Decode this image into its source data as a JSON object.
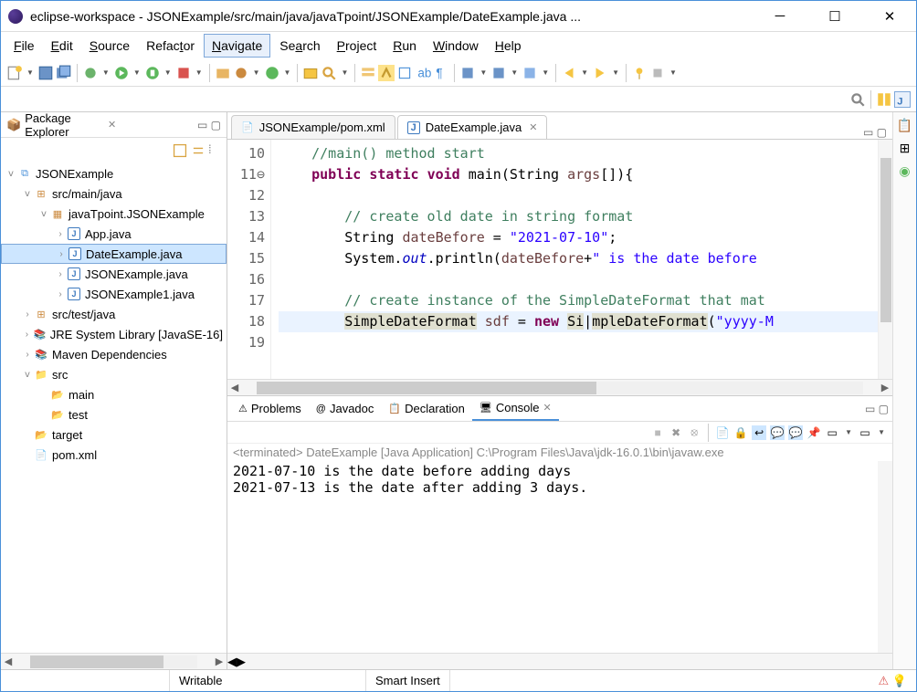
{
  "window": {
    "title": "eclipse-workspace - JSONExample/src/main/java/javaTpoint/JSONExample/DateExample.java ..."
  },
  "menu": {
    "file": "File",
    "edit": "Edit",
    "source": "Source",
    "refactor": "Refactor",
    "navigate": "Navigate",
    "search": "Search",
    "project": "Project",
    "run": "Run",
    "window": "Window",
    "help": "Help"
  },
  "package_explorer": {
    "title": "Package Explorer",
    "items": [
      {
        "label": "JSONExample",
        "depth": 0,
        "icon": "proj",
        "expand": "open"
      },
      {
        "label": "src/main/java",
        "depth": 1,
        "icon": "srcfolder",
        "expand": "open"
      },
      {
        "label": "javaTpoint.JSONExample",
        "depth": 2,
        "icon": "pkg",
        "expand": "open"
      },
      {
        "label": "App.java",
        "depth": 3,
        "icon": "java",
        "expand": "leaf"
      },
      {
        "label": "DateExample.java",
        "depth": 3,
        "icon": "java",
        "expand": "leaf",
        "selected": true
      },
      {
        "label": "JSONExample.java",
        "depth": 3,
        "icon": "java",
        "expand": "leaf"
      },
      {
        "label": "JSONExample1.java",
        "depth": 3,
        "icon": "java",
        "expand": "leaf"
      },
      {
        "label": "src/test/java",
        "depth": 1,
        "icon": "srcfolder",
        "expand": "closed"
      },
      {
        "label": "JRE System Library [JavaSE-16]",
        "depth": 1,
        "icon": "lib",
        "expand": "closed"
      },
      {
        "label": "Maven Dependencies",
        "depth": 1,
        "icon": "lib",
        "expand": "closed"
      },
      {
        "label": "src",
        "depth": 1,
        "icon": "folder",
        "expand": "open"
      },
      {
        "label": "main",
        "depth": 2,
        "icon": "folder-open",
        "expand": "none"
      },
      {
        "label": "test",
        "depth": 2,
        "icon": "folder-open",
        "expand": "none"
      },
      {
        "label": "target",
        "depth": 1,
        "icon": "folder-open",
        "expand": "none"
      },
      {
        "label": "pom.xml",
        "depth": 1,
        "icon": "xml",
        "expand": "none"
      }
    ]
  },
  "editor": {
    "tabs": [
      {
        "label": "JSONExample/pom.xml",
        "icon": "xml"
      },
      {
        "label": "DateExample.java",
        "icon": "java",
        "active": true
      }
    ],
    "lines": [
      {
        "num": "10",
        "html": "    <span class='c-cm'>//main() method start</span>"
      },
      {
        "num": "11",
        "html": "    <span class='c-kw'>public</span> <span class='c-kw'>static</span> <span class='c-kw'>void</span> main(String <span class='c-var'>args</span>[]){",
        "marker": "⊖"
      },
      {
        "num": "12",
        "html": ""
      },
      {
        "num": "13",
        "html": "        <span class='c-cm'>// create old date in string format</span>"
      },
      {
        "num": "14",
        "html": "        String <span class='c-var'>dateBefore</span> = <span class='c-str'>\"2021-07-10\"</span>;"
      },
      {
        "num": "15",
        "html": "        System.<span class='c-st'>out</span>.println(<span class='c-var'>dateBefore</span>+<span class='c-str'>\" is the date before </span>"
      },
      {
        "num": "16",
        "html": ""
      },
      {
        "num": "17",
        "html": "        <span class='c-cm'>// create instance of the SimpleDateFormat that mat</span>"
      },
      {
        "num": "18",
        "html": "        <span class='hl-ident'>SimpleDateFormat</span> <span class='c-var'>sdf</span> = <span class='c-kw'>new</span> <span class='hl-ident'>Si</span>|<span class='hl-ident'>mpleDateFormat</span>(<span class='c-str'>\"yyyy-M</span>",
        "hl": true
      },
      {
        "num": "19",
        "html": ""
      }
    ]
  },
  "bottom": {
    "tabs": [
      {
        "label": "Problems",
        "icon": "problems"
      },
      {
        "label": "Javadoc",
        "icon": "javadoc"
      },
      {
        "label": "Declaration",
        "icon": "decl"
      },
      {
        "label": "Console",
        "icon": "console",
        "active": true
      }
    ],
    "terminated": "<terminated> DateExample [Java Application] C:\\Program Files\\Java\\jdk-16.0.1\\bin\\javaw.exe",
    "output": [
      "2021-07-10 is the date before adding days",
      "2021-07-13 is the date after adding 3 days."
    ]
  },
  "status": {
    "writable": "Writable",
    "insert": "Smart Insert"
  }
}
